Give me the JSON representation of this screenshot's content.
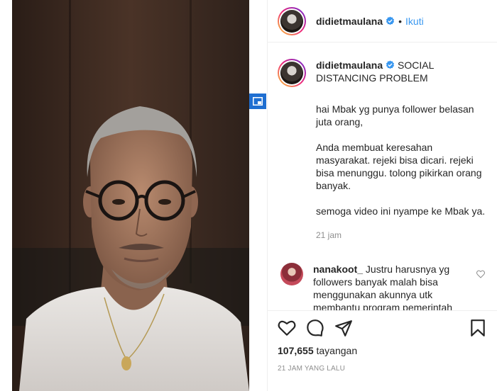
{
  "header": {
    "username": "didietmaulana",
    "separator": "•",
    "follow_label": "Ikuti"
  },
  "caption": {
    "username": "didietmaulana",
    "title": "SOCIAL DISTANCING PROBLEM",
    "paragraphs": [
      "hai Mbak yg punya follower belasan juta orang,",
      "Anda membuat keresahan masyarakat. rejeki bisa dicari. rejeki bisa menunggu. tolong pikirkan orang banyak.",
      "semoga video ini nyampe ke Mbak ya."
    ],
    "time": "21 jam"
  },
  "comment": {
    "username": "nanakoot_",
    "text": "Justru harusnya yg followers banyak malah bisa menggunakan akunnya utk membantu program pemerintah soal Social Distancing dan menggunakan akun tersebut utk"
  },
  "stats": {
    "views_count": "107,655",
    "views_label": "tayangan",
    "date": "21 JAM YANG LALU"
  },
  "colors": {
    "accent": "#3897f0",
    "verified": "#3897f0",
    "pip_button": "#1f6fd1",
    "muted_text": "#8e8e8e"
  },
  "icons": {
    "header_verified": "verified-badge-icon",
    "like": "heart-icon",
    "comment": "comment-bubble-icon",
    "share": "paper-plane-icon",
    "save": "bookmark-icon",
    "pip": "picture-in-picture-icon"
  }
}
